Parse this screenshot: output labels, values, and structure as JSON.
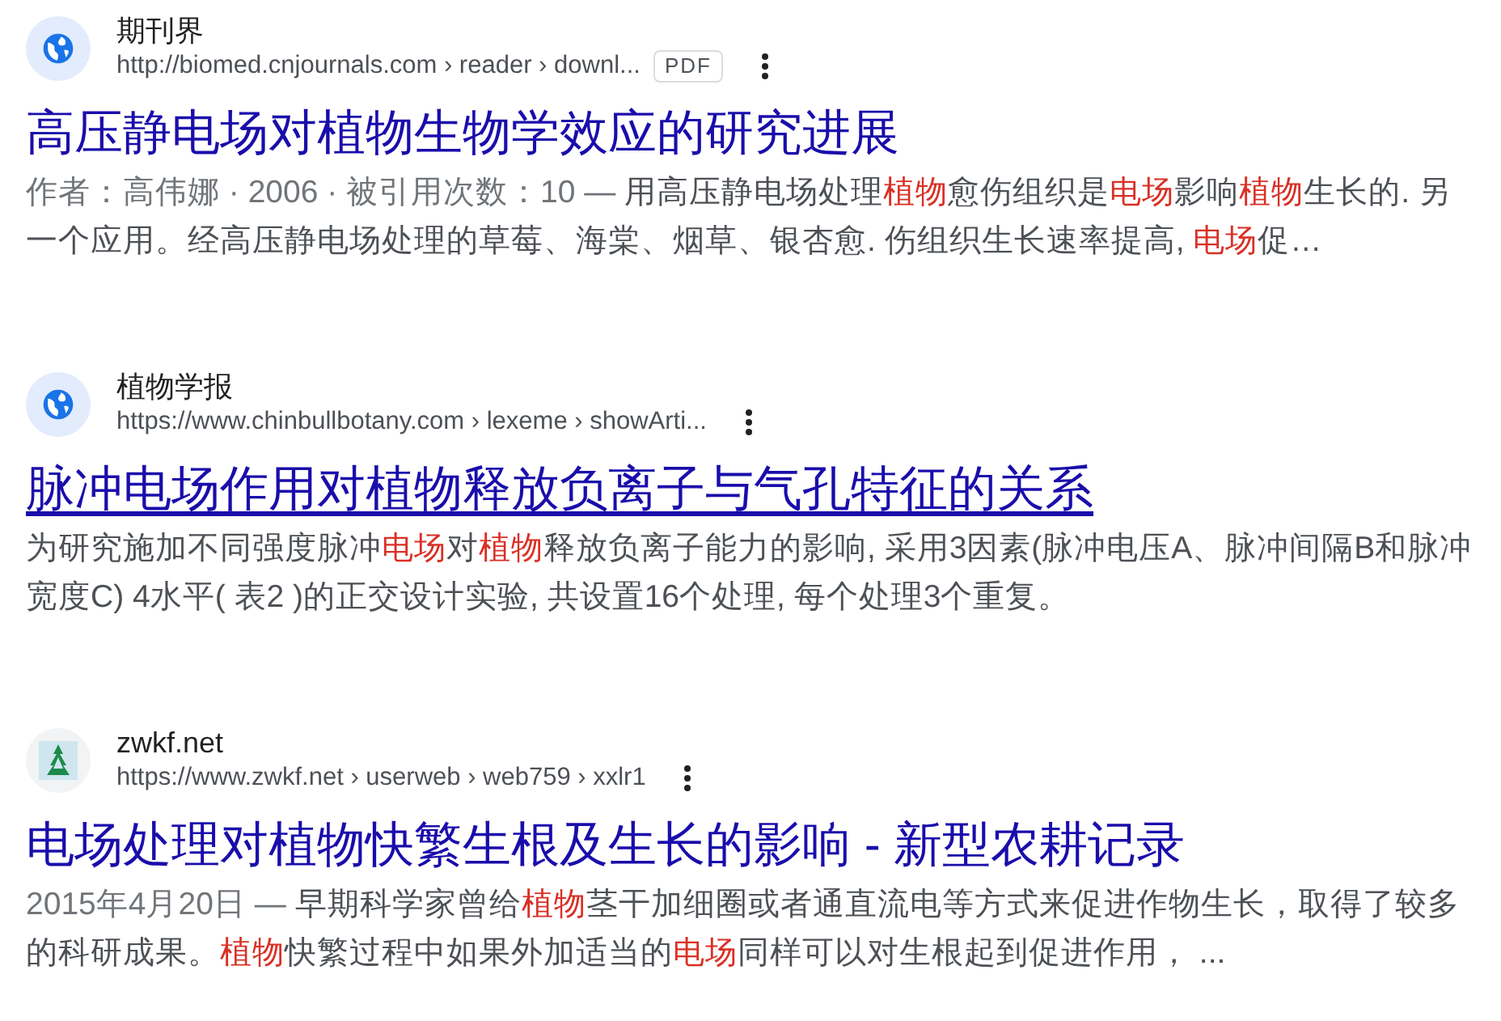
{
  "results": [
    {
      "site": "期刊界",
      "url": "http://biomed.cnjournals.com › reader › downl...",
      "file_type": "PDF",
      "kind": "globe",
      "title": "高压静电场对植物生物学效应的研究进展",
      "underlined": false,
      "snippet": [
        {
          "kind": "meta",
          "text": "作者：高伟娜 · 2006 · 被引用次数：10 — "
        },
        {
          "kind": "text",
          "text": "用高压静电场处理"
        },
        {
          "kind": "highlight",
          "text": "植物"
        },
        {
          "kind": "text",
          "text": "愈伤组织是"
        },
        {
          "kind": "highlight",
          "text": "电场"
        },
        {
          "kind": "text",
          "text": "影响"
        },
        {
          "kind": "highlight",
          "text": "植物"
        },
        {
          "kind": "text",
          "text": "生长的. 另一个应用。经高压静电场处理的草莓、海棠、烟草、银杏愈. 伤组织生长速率提高, "
        },
        {
          "kind": "highlight",
          "text": "电场"
        },
        {
          "kind": "text",
          "text": "促…"
        }
      ]
    },
    {
      "site": "植物学报",
      "url": "https://www.chinbullbotany.com › lexeme › showArti...",
      "kind": "globe",
      "title": "脉冲电场作用对植物释放负离子与气孔特征的关系",
      "underlined": true,
      "snippet": [
        {
          "kind": "text",
          "text": "为研究施加不同强度脉冲"
        },
        {
          "kind": "highlight",
          "text": "电场"
        },
        {
          "kind": "text",
          "text": "对"
        },
        {
          "kind": "highlight",
          "text": "植物"
        },
        {
          "kind": "text",
          "text": "释放负离子能力的影响, 采用3因素(脉冲电压A、脉冲间隔B和脉冲宽度C) 4水平( 表2 )的正交设计实验, 共设置16个处理, 每个处理3个重复。"
        }
      ]
    },
    {
      "site": "zwkf.net",
      "url": "https://www.zwkf.net › userweb › web759 › xxlr1",
      "kind": "tree",
      "title": "电场处理对植物快繁生根及生长的影响 - 新型农耕记录",
      "underlined": false,
      "snippet": [
        {
          "kind": "meta",
          "text": "2015年4月20日 — "
        },
        {
          "kind": "text",
          "text": "早期科学家曾给"
        },
        {
          "kind": "highlight",
          "text": "植物"
        },
        {
          "kind": "text",
          "text": "茎干加细圈或者通直流电等方式来促进作物生长，取得了较多的科研成果。"
        },
        {
          "kind": "highlight",
          "text": "植物"
        },
        {
          "kind": "text",
          "text": "快繁过程中如果外加适当的"
        },
        {
          "kind": "highlight",
          "text": "电场"
        },
        {
          "kind": "text",
          "text": "同样可以对生根起到促进作用，  ..."
        }
      ]
    }
  ]
}
